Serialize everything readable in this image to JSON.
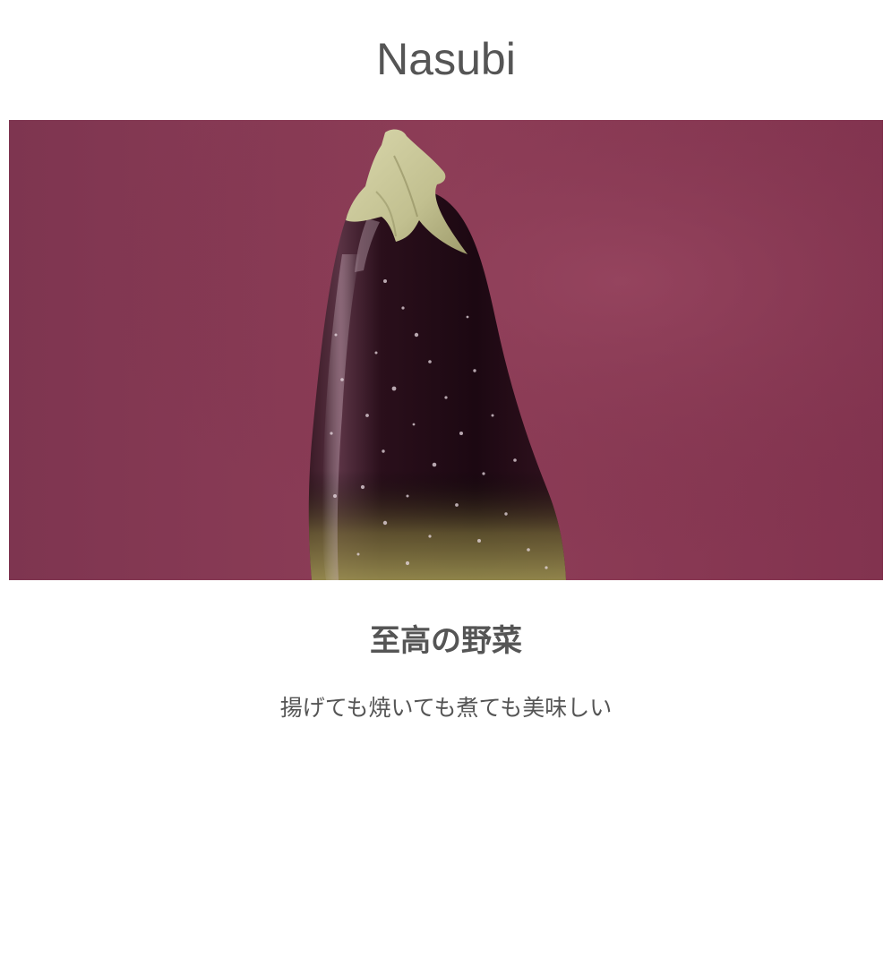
{
  "header": {
    "title": "Nasubi"
  },
  "hero": {
    "subject": "eggplant-photo",
    "colors": {
      "background": "#8a3a55",
      "eggplant_skin": "#2a121d",
      "calyx": "#c9c79a"
    }
  },
  "main": {
    "headline": "至高の野菜",
    "tagline": "揚げても焼いても煮ても美味しい"
  }
}
